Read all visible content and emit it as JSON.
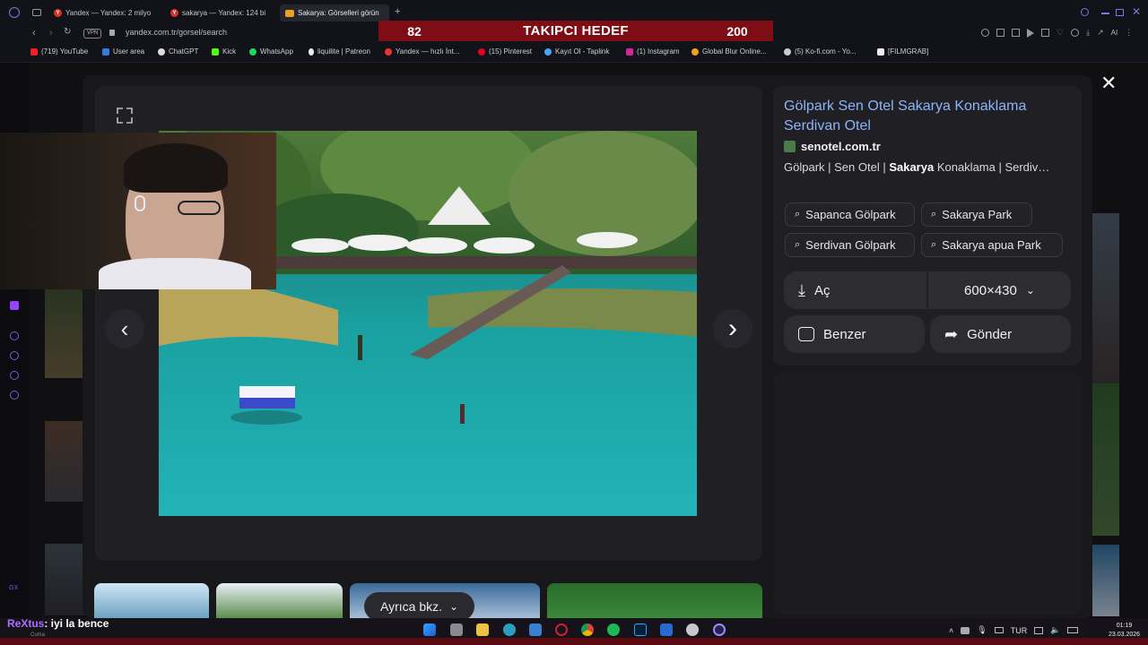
{
  "browser": {
    "tabs": [
      {
        "label": "Yandex — Yandex: 2 milyo"
      },
      {
        "label": "sakarya — Yandex: 124 bi"
      },
      {
        "label": "Sakarya: Görselleri görün"
      }
    ],
    "url": "yandex.com.tr/gorsel/search",
    "vpn_label": "VPN",
    "bookmarks": [
      {
        "label": "(719) YouTube",
        "color": "#e22"
      },
      {
        "label": "User area",
        "color": "#3a7bd5"
      },
      {
        "label": "ChatGPT",
        "color": "#ddd"
      },
      {
        "label": "Kick",
        "color": "#53fc18"
      },
      {
        "label": "WhatsApp",
        "color": "#25d366"
      },
      {
        "label": "liquilite | Patreon",
        "color": "#eee"
      },
      {
        "label": "Yandex — hızlı İnt...",
        "color": "#e33"
      },
      {
        "label": "(15) Pinterest",
        "color": "#e60023"
      },
      {
        "label": "Kayıt Ol - Taplink",
        "color": "#4aa3ff"
      },
      {
        "label": "(1) Instagram",
        "color": "#d6249f"
      },
      {
        "label": "Global Blur Online...",
        "color": "#f0a020"
      },
      {
        "label": "(5) Ko-fi.com - Yo...",
        "color": "#ccc"
      },
      {
        "label": "[FILMGRAB]",
        "color": "#eee"
      }
    ],
    "toolbar_right_label": "AI"
  },
  "overlay": {
    "left_value": "82",
    "title": "TAKIPCI HEDEF",
    "right_value": "200"
  },
  "viewer": {
    "title": "Gölpark Sen Otel Sakarya Konaklama Serdivan Otel",
    "site": "senotel.com.tr",
    "description_pre": "Gölpark | Sen Otel | ",
    "description_bold": "Sakarya",
    "description_post": " Konaklama | Serdiv…",
    "chips": [
      {
        "label": "Sapanca Gölpark"
      },
      {
        "label": "Sakarya Park"
      },
      {
        "label": "Serdivan Gölpark"
      },
      {
        "label": "Sakarya apua Park"
      }
    ],
    "open_label": "Aç",
    "size_label": "600×430",
    "similar_label": "Benzer",
    "share_label": "Gönder",
    "see_also_label": "Ayrıca bkz."
  },
  "stream": {
    "chat_user": "ReXtus",
    "chat_text": ": iyi la bence",
    "chat_sub": "Cuma"
  },
  "taskbar": {
    "lang": "TUR",
    "time": "01:19",
    "date": "23.03.2026"
  },
  "colors": {
    "title_link": "#8ab4f8",
    "overlay_bg": "#7e0d15",
    "accent_purple": "#6d62d8"
  }
}
